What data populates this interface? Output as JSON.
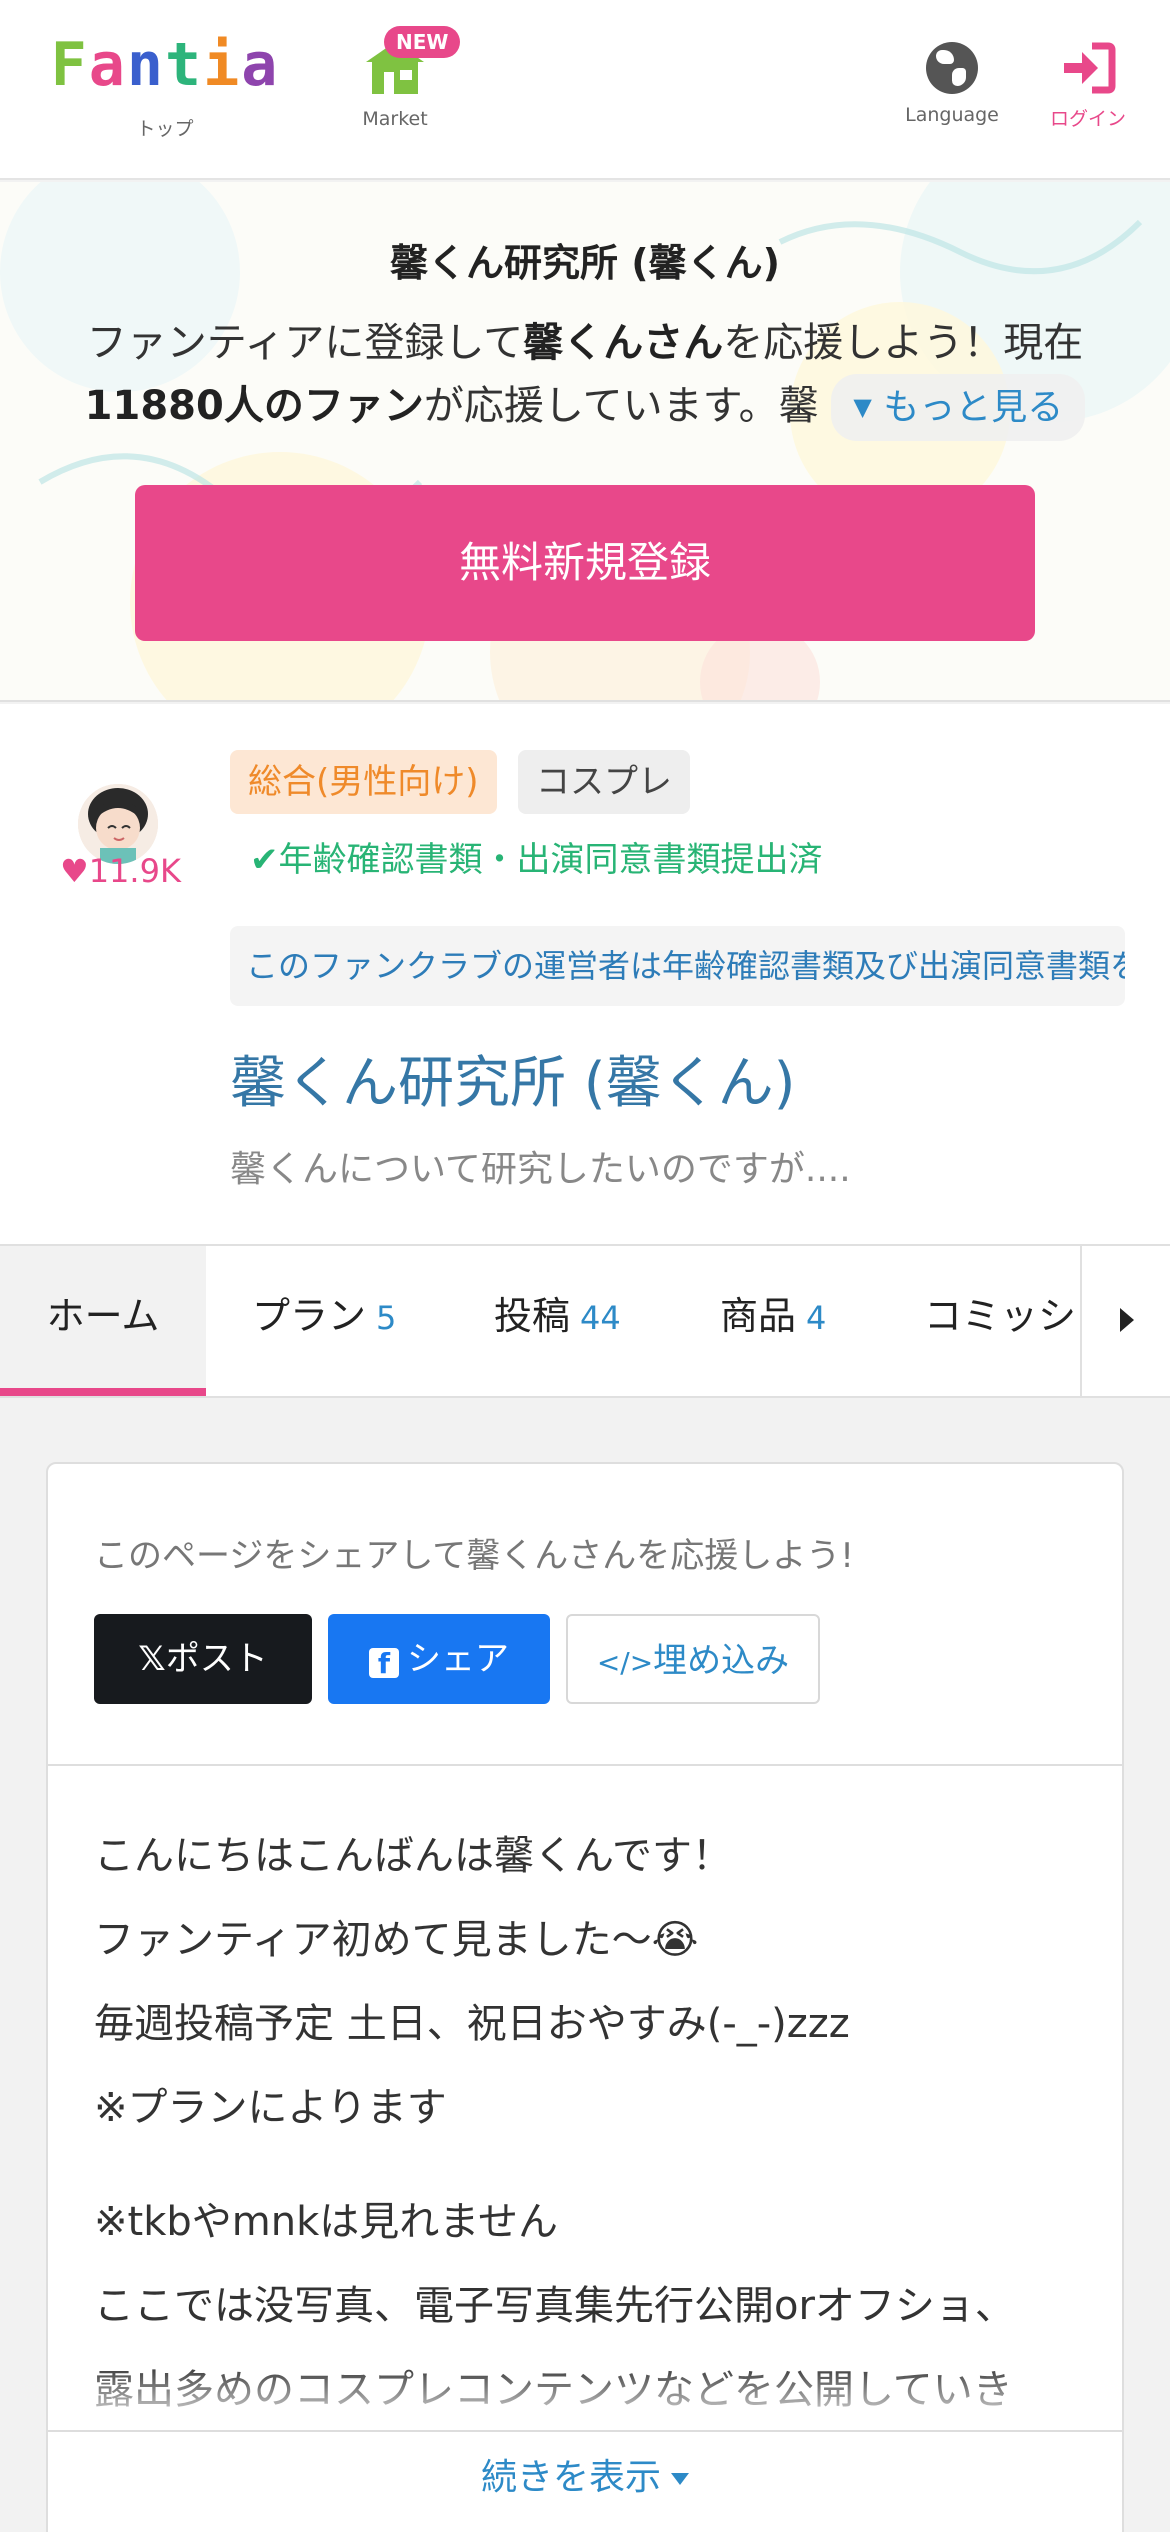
{
  "header": {
    "logo_text": "Fantia",
    "logo_colors": [
      "#7fc241",
      "#e8488a",
      "#3a5fcd",
      "#2db47b",
      "#f08a24",
      "#8e44ad"
    ],
    "nav": [
      {
        "label": "トップ"
      },
      {
        "label": "Market",
        "badge": "NEW"
      },
      {
        "label": "Language"
      },
      {
        "label": "ログイン"
      }
    ]
  },
  "hero": {
    "title": "馨くん研究所 (馨くん)",
    "desc_pre": "ファンティアに登録して",
    "desc_name": "馨くんさん",
    "desc_mid": "を応援しよう！現在",
    "desc_fans": "11880人のファン",
    "desc_post": "が応援しています。馨",
    "more_label": "もっと見る",
    "signup_label": "無料新規登録"
  },
  "profile": {
    "likes": "11.9K",
    "tags": [
      "総合(男性向け)",
      "コスプレ"
    ],
    "verified": "年齢確認書類・出演同意書類提出済",
    "notice": "このファンクラブの運営者は年齢確認書類及び出演同意書類を提出済みです",
    "name": "馨くん研究所 (馨くん)",
    "catchphrase": "馨くんについて研究したいのですが...."
  },
  "tabs": [
    {
      "label": "ホーム",
      "count": ""
    },
    {
      "label": "プラン",
      "count": "5"
    },
    {
      "label": "投稿",
      "count": "44"
    },
    {
      "label": "商品",
      "count": "4"
    },
    {
      "label": "コミッション",
      "count": ""
    }
  ],
  "share": {
    "text": "このページをシェアして馨くんさんを応援しよう!",
    "x_label": "ポスト",
    "fb_label": "シェア",
    "embed_label": "埋め込み"
  },
  "body": {
    "lines1": [
      "こんにちはこんばんは馨くんです！",
      "ファンティア初めて見ました〜😭",
      "毎週投稿予定 土日、祝日おやすみ(-_-)zzz",
      "※プランによります"
    ],
    "lines2": [
      "※tkbやmnkは見れません",
      "ここでは没写真、電子写真集先行公開orオフショ、",
      "露出多めのコスプレコンテンツなどを公開していき"
    ],
    "continue_label": "続きを表示"
  }
}
